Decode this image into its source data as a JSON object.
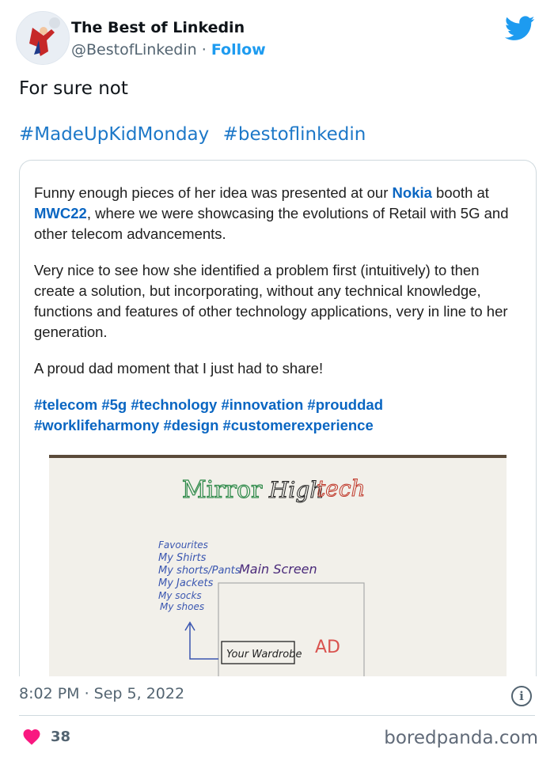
{
  "author": {
    "name": "The Best of Linkedin",
    "handle": "@BestofLinkedin",
    "separator": "·",
    "follow_label": "Follow"
  },
  "tweet": {
    "text": "For sure not",
    "hashtags": [
      "#MadeUpKidMonday",
      "#bestoflinkedin"
    ]
  },
  "embedded_post": {
    "p1_a": "Funny enough pieces of her idea was presented at our ",
    "p1_nokia": "Nokia",
    "p1_b": " booth at ",
    "p1_mwc": "MWC22",
    "p1_c": ", where we were showcasing the evolutions of Retail with 5G and other telecom advancements.",
    "p2": "Very nice to see how she identified a problem first (intuitively) to then create a solution, but incorporating, without any technical knowledge, functions and features of other technology applications, very in line to her generation.",
    "p3": "A proud dad moment that I just had to share!",
    "hashtags_line1": "#telecom #5g #technology #innovation #prouddad",
    "hashtags_line2": "#worklifeharmony #design #customerexperience",
    "drawing": {
      "title_mirror": "Mirror",
      "title_high": "High",
      "title_tech": "tech",
      "list": [
        "Favourites",
        "My Shirts",
        "My shorts/Pants",
        "My Jackets",
        "My socks",
        "My shoes"
      ],
      "main_screen": "Main Screen",
      "wardrobe": "Your Wardrobe",
      "ad": "AD"
    }
  },
  "meta": {
    "timestamp": "8:02 PM · Sep 5, 2022",
    "likes": "38",
    "watermark": "boredpanda.com"
  },
  "colors": {
    "link": "#1d9bf0",
    "hashtag": "#1d78c8",
    "linkedin_blue": "#0a66c2",
    "heart": "#f91880"
  },
  "icons": [
    "twitter-bird-icon",
    "info-icon",
    "heart-icon"
  ]
}
